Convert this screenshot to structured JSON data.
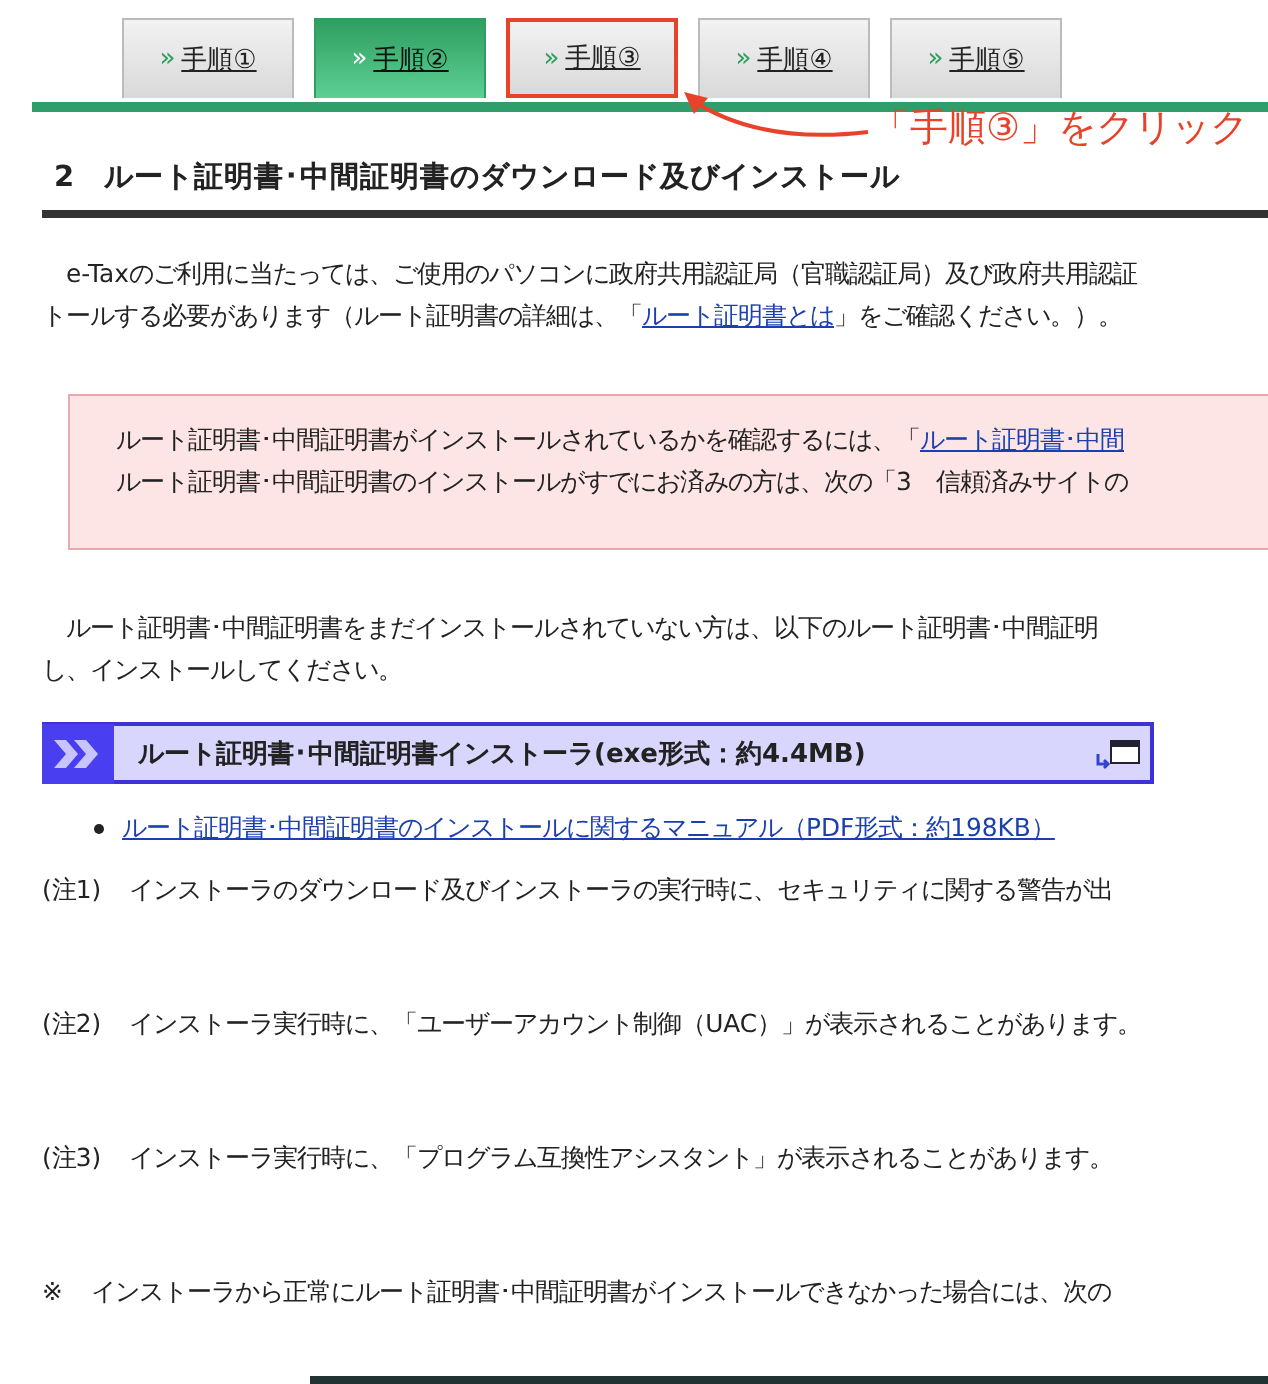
{
  "tabs": [
    {
      "mark": "»",
      "label": "手順①",
      "selected": false,
      "highlighted": false
    },
    {
      "mark": "»",
      "label": "手順②",
      "selected": true,
      "highlighted": false
    },
    {
      "mark": "»",
      "label": "手順③",
      "selected": false,
      "highlighted": true
    },
    {
      "mark": "»",
      "label": "手順④",
      "selected": false,
      "highlighted": false
    },
    {
      "mark": "»",
      "label": "手順⑤",
      "selected": false,
      "highlighted": false
    }
  ],
  "callout": "「手順③」をクリック",
  "heading": "2　ルート証明書･中間証明書のダウンロード及びインストール",
  "intro": [
    [
      {
        "text": "　e-Taxのご利用に当たっては、ご使用のパソコンに政府共用認証局（官職認証局）及び政府共用認証",
        "kind": "text"
      }
    ],
    [
      {
        "text": "トールする必要があります（ルート証明書の詳細は、「",
        "kind": "text"
      },
      {
        "text": "ルート証明書とは",
        "kind": "link"
      },
      {
        "text": "」をご確認ください。）。",
        "kind": "text"
      }
    ]
  ],
  "notice": [
    [
      {
        "text": "ルート証明書･中間証明書がインストールされているかを確認するには、「",
        "kind": "text"
      },
      {
        "text": "ルート証明書･中間",
        "kind": "link"
      }
    ],
    [
      {
        "text": "ルート証明書･中間証明書のインストールがすでにお済みの方は、次の「3　信頼済みサイトの",
        "kind": "text"
      }
    ]
  ],
  "instruction": [
    "　ルート証明書･中間証明書をまだインストールされていない方は、以下のルート証明書･中間証明",
    "し、インストールしてください。"
  ],
  "installer": {
    "label": "ルート証明書･中間証明書インストーラ(exe形式：約4.4MB)"
  },
  "manual_link": "ルート証明書･中間証明書のインストールに関するマニュアル（PDF形式：約198KB）",
  "notes": [
    {
      "mark": "(注1)",
      "text": "インストーラのダウンロード及びインストーラの実行時に、セキュリティに関する警告が出"
    },
    {
      "mark": "(注2)",
      "text": "インストーラ実行時に、「ユーザーアカウント制御（UAC）」が表示されることがあります。"
    },
    {
      "mark": "(注3)",
      "text": "インストーラ実行時に、「プログラム互換性アシスタント」が表示されることがあります。"
    },
    {
      "mark": "※",
      "text": "インストーラから正常にルート証明書･中間証明書がインストールできなかった場合には、次の"
    }
  ]
}
